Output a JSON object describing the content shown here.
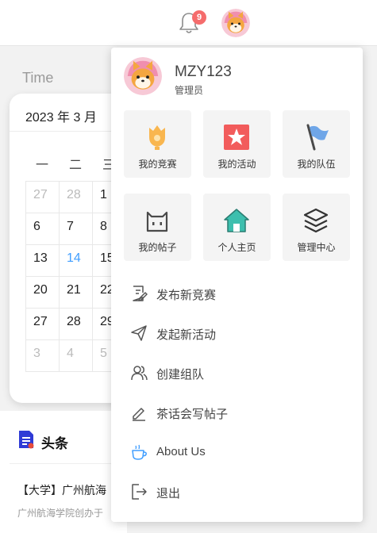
{
  "header": {
    "notification_count": "9"
  },
  "calendar": {
    "section_label": "Time",
    "month_title": "2023 年 3 月",
    "weekdays": [
      "一",
      "二",
      "三"
    ],
    "rows": [
      [
        "27",
        "28",
        "1"
      ],
      [
        "6",
        "7",
        "8"
      ],
      [
        "13",
        "14",
        "15"
      ],
      [
        "20",
        "21",
        "22"
      ],
      [
        "27",
        "28",
        "29"
      ],
      [
        "3",
        "4",
        "5"
      ]
    ]
  },
  "news": {
    "title": "头条",
    "headline": "【大学】广州航海",
    "snippet": "广州航海学院创办于"
  },
  "user_menu": {
    "username": "MZY123",
    "role": "管理员",
    "tiles": [
      {
        "label": "我的竞赛",
        "icon": "trophy-icon"
      },
      {
        "label": "我的活动",
        "icon": "star-icon"
      },
      {
        "label": "我的队伍",
        "icon": "flag-icon"
      },
      {
        "label": "我的帖子",
        "icon": "post-icon"
      },
      {
        "label": "个人主页",
        "icon": "home-icon"
      },
      {
        "label": "管理中心",
        "icon": "layers-icon"
      }
    ],
    "items": [
      {
        "label": "发布新竞赛",
        "icon": "edit-document-icon"
      },
      {
        "label": "发起新活动",
        "icon": "send-icon"
      },
      {
        "label": "创建组队",
        "icon": "users-icon"
      },
      {
        "label": "茶话会写帖子",
        "icon": "pen-icon"
      },
      {
        "label": "About Us",
        "icon": "coffee-cup-icon"
      },
      {
        "label": "退出",
        "icon": "logout-icon"
      }
    ]
  },
  "colors": {
    "accent_blue": "#409eff",
    "badge_red": "#f56c6c",
    "star_red": "#f25c5c",
    "trophy_orange": "#f9b64f",
    "home_teal": "#3dbfae",
    "flag_blue": "#6fa6e8"
  }
}
